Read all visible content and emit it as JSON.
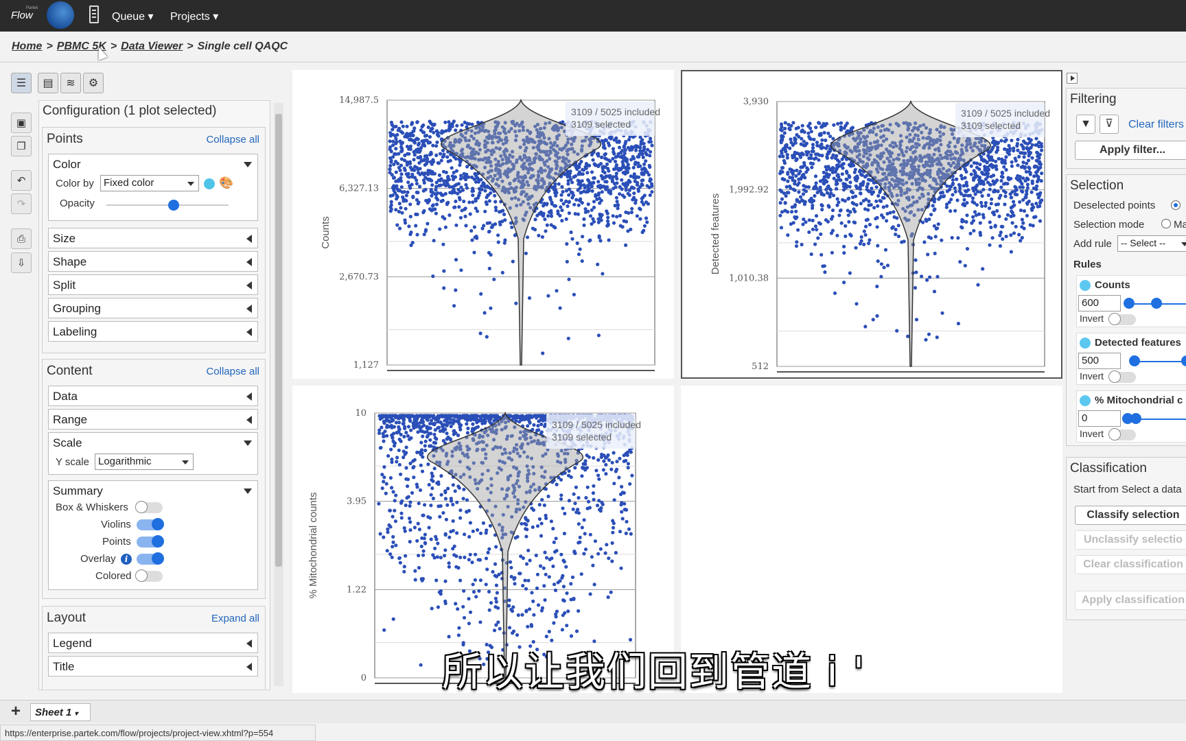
{
  "app": {
    "logo_small": "Partek",
    "logo": "Flow",
    "nav": [
      "Queue",
      "Projects"
    ]
  },
  "breadcrumb": [
    "Home",
    "PBMC 5K",
    "Data Viewer",
    "Single cell QAQC"
  ],
  "config": {
    "title": "Configuration (1 plot selected)",
    "points": {
      "title": "Points",
      "link": "Collapse all",
      "color": {
        "title": "Color",
        "color_by_label": "Color by",
        "color_by_value": "Fixed color",
        "opacity_label": "Opacity",
        "opacity": 0.55
      },
      "rows": [
        "Size",
        "Shape",
        "Split",
        "Grouping",
        "Labeling"
      ]
    },
    "content": {
      "title": "Content",
      "link": "Collapse all",
      "rows": [
        "Data",
        "Range"
      ],
      "scale": {
        "title": "Scale",
        "yscale_label": "Y scale",
        "yscale_value": "Logarithmic"
      },
      "summary": {
        "title": "Summary",
        "items": [
          {
            "label": "Box & Whiskers",
            "on": false
          },
          {
            "label": "Violins",
            "on": true
          },
          {
            "label": "Points",
            "on": true
          },
          {
            "label": "Overlay",
            "on": true
          },
          {
            "label": "Colored",
            "on": false
          }
        ]
      }
    },
    "layout": {
      "title": "Layout",
      "link": "Expand all",
      "rows": [
        "Legend",
        "Title"
      ]
    }
  },
  "plots": [
    {
      "ylabel": "Counts",
      "ticks": [
        "14,987.5",
        "6,327.13",
        "2,670.73",
        "1,127"
      ],
      "included": "3109 / 5025 included",
      "selected": "3109 selected"
    },
    {
      "ylabel": "Detected features",
      "ticks": [
        "3,930",
        "1,992.92",
        "1,010.38",
        "512"
      ],
      "included": "3109 / 5025 included",
      "selected": "3109 selected"
    },
    {
      "ylabel": "% Mitochondrial counts",
      "ticks": [
        "10",
        "3.95",
        "1.22",
        "0"
      ],
      "included": "3109 / 5025 included",
      "selected": "3109 selected"
    }
  ],
  "right": {
    "filtering": {
      "title": "Filtering",
      "clear": "Clear filters",
      "apply": "Apply filter..."
    },
    "selection": {
      "title": "Selection",
      "deselected_label": "Deselected points",
      "mode_label": "Selection mode",
      "mode_value": "Ma",
      "add_rule_label": "Add rule",
      "add_rule_value": "-- Select --",
      "rules_label": "Rules",
      "invert_label": "Invert",
      "rules": [
        {
          "name": "Counts",
          "value": "600"
        },
        {
          "name": "Detected features",
          "value": "500"
        },
        {
          "name": "% Mitochondrial c",
          "value": "0"
        }
      ]
    },
    "classification": {
      "title": "Classification",
      "start_from": "Start from Select a data",
      "buttons": [
        "Classify selection",
        "Unclassify selectio",
        "Clear classification",
        "Apply classification"
      ]
    }
  },
  "sheet": {
    "tab": "Sheet 1"
  },
  "status_url": "https://enterprise.partek.com/flow/projects/project-view.xhtml?p=554",
  "subtitle": "所以让我们回到管道 i '"
}
